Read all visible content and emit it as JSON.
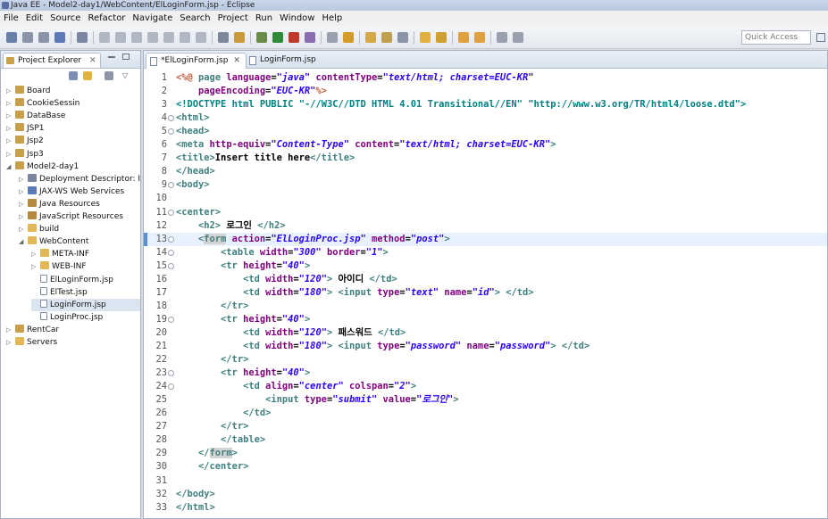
{
  "window": {
    "title": "Java EE - Model2-day1/WebContent/ElLoginForm.jsp - Eclipse"
  },
  "menu": [
    "File",
    "Edit",
    "Source",
    "Refactor",
    "Navigate",
    "Search",
    "Project",
    "Run",
    "Window",
    "Help"
  ],
  "quick_access": {
    "placeholder": "Quick Access"
  },
  "explorer": {
    "title": "Project Explorer",
    "items": [
      {
        "label": "Board",
        "depth": 0,
        "kind": "project",
        "open": false
      },
      {
        "label": "CookieSessin",
        "depth": 0,
        "kind": "project",
        "open": false
      },
      {
        "label": "DataBase",
        "depth": 0,
        "kind": "project",
        "open": false
      },
      {
        "label": "JSP1",
        "depth": 0,
        "kind": "project",
        "open": false
      },
      {
        "label": "Jsp2",
        "depth": 0,
        "kind": "project",
        "open": false
      },
      {
        "label": "Jsp3",
        "depth": 0,
        "kind": "project",
        "open": false
      },
      {
        "label": "Model2-day1",
        "depth": 0,
        "kind": "project",
        "open": true
      },
      {
        "label": "Deployment Descriptor: I",
        "depth": 1,
        "kind": "descriptor",
        "open": false
      },
      {
        "label": "JAX-WS Web Services",
        "depth": 1,
        "kind": "services",
        "open": false
      },
      {
        "label": "Java Resources",
        "depth": 1,
        "kind": "resources",
        "open": false
      },
      {
        "label": "JavaScript Resources",
        "depth": 1,
        "kind": "resources",
        "open": false
      },
      {
        "label": "build",
        "depth": 1,
        "kind": "folder",
        "open": false
      },
      {
        "label": "WebContent",
        "depth": 1,
        "kind": "folder",
        "open": true
      },
      {
        "label": "META-INF",
        "depth": 2,
        "kind": "folder",
        "open": false
      },
      {
        "label": "WEB-INF",
        "depth": 2,
        "kind": "folder",
        "open": false
      },
      {
        "label": "ElLoginForm.jsp",
        "depth": 2,
        "kind": "file",
        "open": null
      },
      {
        "label": "ElTest.jsp",
        "depth": 2,
        "kind": "file",
        "open": null
      },
      {
        "label": "LoginForm.jsp",
        "depth": 2,
        "kind": "file",
        "open": null,
        "selected": true
      },
      {
        "label": "LoginProc.jsp",
        "depth": 2,
        "kind": "file",
        "open": null
      },
      {
        "label": "RentCar",
        "depth": 0,
        "kind": "project",
        "open": false
      },
      {
        "label": "Servers",
        "depth": 0,
        "kind": "folder",
        "open": false
      }
    ]
  },
  "editor": {
    "tabs": [
      {
        "label": "*ElLoginForm.jsp",
        "active": true
      },
      {
        "label": "LoginForm.jsp",
        "active": false
      }
    ],
    "current_line": 13,
    "lines": [
      {
        "n": "1",
        "fold": false,
        "t": [
          [
            "j",
            "<%@"
          ],
          [
            "p",
            " "
          ],
          [
            "k",
            "page"
          ],
          [
            "p",
            " "
          ],
          [
            "a",
            "language"
          ],
          [
            "p",
            "="
          ],
          [
            "s",
            "\"java\""
          ],
          [
            "p",
            " "
          ],
          [
            "a",
            "contentType"
          ],
          [
            "p",
            "="
          ],
          [
            "s",
            "\"text/html; charset=EUC-KR\""
          ]
        ]
      },
      {
        "n": "2",
        "fold": false,
        "t": [
          [
            "p",
            "    "
          ],
          [
            "a",
            "pageEncoding"
          ],
          [
            "p",
            "="
          ],
          [
            "s",
            "\"EUC-KR\""
          ],
          [
            "j",
            "%>"
          ]
        ]
      },
      {
        "n": "3",
        "fold": false,
        "t": [
          [
            "d",
            "<!DOCTYPE"
          ],
          [
            "p",
            " "
          ],
          [
            "d",
            "html"
          ],
          [
            "p",
            " "
          ],
          [
            "d",
            "PUBLIC"
          ],
          [
            "p",
            " "
          ],
          [
            "d",
            "\"-//W3C//DTD HTML 4.01 Transitional//EN\""
          ],
          [
            "p",
            " "
          ],
          [
            "d",
            "\"http://www.w3.org/TR/html4/loose.dtd\""
          ],
          [
            "d",
            ">"
          ]
        ]
      },
      {
        "n": "4",
        "fold": true,
        "t": [
          [
            "k",
            "<html>"
          ]
        ]
      },
      {
        "n": "5",
        "fold": true,
        "t": [
          [
            "k",
            "<head>"
          ]
        ]
      },
      {
        "n": "6",
        "fold": false,
        "t": [
          [
            "k",
            "<meta"
          ],
          [
            "p",
            " "
          ],
          [
            "a",
            "http-equiv"
          ],
          [
            "p",
            "="
          ],
          [
            "s",
            "\"Content-Type\""
          ],
          [
            "p",
            " "
          ],
          [
            "a",
            "content"
          ],
          [
            "p",
            "="
          ],
          [
            "s",
            "\"text/html; charset=EUC-KR\""
          ],
          [
            "k",
            ">"
          ]
        ]
      },
      {
        "n": "7",
        "fold": false,
        "t": [
          [
            "k",
            "<title>"
          ],
          [
            "p",
            "Insert title here"
          ],
          [
            "k",
            "</title>"
          ]
        ]
      },
      {
        "n": "8",
        "fold": false,
        "t": [
          [
            "k",
            "</head>"
          ]
        ]
      },
      {
        "n": "9",
        "fold": true,
        "t": [
          [
            "k",
            "<body>"
          ]
        ]
      },
      {
        "n": "10",
        "fold": false,
        "t": []
      },
      {
        "n": "11",
        "fold": true,
        "t": [
          [
            "k",
            "<center>"
          ]
        ]
      },
      {
        "n": "12",
        "fold": false,
        "t": [
          [
            "p",
            "    "
          ],
          [
            "k",
            "<h2>"
          ],
          [
            "p",
            " 로그인 "
          ],
          [
            "k",
            "</h2>"
          ]
        ]
      },
      {
        "n": "13",
        "fold": true,
        "t": [
          [
            "p",
            "    "
          ],
          [
            "k",
            "<"
          ],
          [
            "k",
            "form",
            "hl"
          ],
          [
            "p",
            " "
          ],
          [
            "a",
            "action"
          ],
          [
            "p",
            "="
          ],
          [
            "s",
            "\"ElLoginProc.jsp\""
          ],
          [
            "p",
            " "
          ],
          [
            "a",
            "method"
          ],
          [
            "p",
            "="
          ],
          [
            "s",
            "\"post\""
          ],
          [
            "k",
            ">"
          ]
        ]
      },
      {
        "n": "14",
        "fold": true,
        "t": [
          [
            "p",
            "        "
          ],
          [
            "k",
            "<table"
          ],
          [
            "p",
            " "
          ],
          [
            "a",
            "width"
          ],
          [
            "p",
            "="
          ],
          [
            "s",
            "\"300\""
          ],
          [
            "p",
            " "
          ],
          [
            "a",
            "border"
          ],
          [
            "p",
            "="
          ],
          [
            "s",
            "\"1\""
          ],
          [
            "k",
            ">"
          ]
        ]
      },
      {
        "n": "15",
        "fold": true,
        "t": [
          [
            "p",
            "        "
          ],
          [
            "k",
            "<tr"
          ],
          [
            "p",
            " "
          ],
          [
            "a",
            "height"
          ],
          [
            "p",
            "="
          ],
          [
            "s",
            "\"40\""
          ],
          [
            "k",
            ">"
          ]
        ]
      },
      {
        "n": "16",
        "fold": false,
        "t": [
          [
            "p",
            "            "
          ],
          [
            "k",
            "<td"
          ],
          [
            "p",
            " "
          ],
          [
            "a",
            "width"
          ],
          [
            "p",
            "="
          ],
          [
            "s",
            "\"120\""
          ],
          [
            "k",
            ">"
          ],
          [
            "p",
            " 아이디 "
          ],
          [
            "k",
            "</td>"
          ]
        ]
      },
      {
        "n": "17",
        "fold": false,
        "t": [
          [
            "p",
            "            "
          ],
          [
            "k",
            "<td"
          ],
          [
            "p",
            " "
          ],
          [
            "a",
            "width"
          ],
          [
            "p",
            "="
          ],
          [
            "s",
            "\"180\""
          ],
          [
            "k",
            ">"
          ],
          [
            "p",
            " "
          ],
          [
            "k",
            "<input"
          ],
          [
            "p",
            " "
          ],
          [
            "a",
            "type"
          ],
          [
            "p",
            "="
          ],
          [
            "s",
            "\"text\""
          ],
          [
            "p",
            " "
          ],
          [
            "a",
            "name"
          ],
          [
            "p",
            "="
          ],
          [
            "s",
            "\"id\""
          ],
          [
            "k",
            ">"
          ],
          [
            "p",
            " "
          ],
          [
            "k",
            "</td>"
          ]
        ]
      },
      {
        "n": "18",
        "fold": false,
        "t": [
          [
            "p",
            "        "
          ],
          [
            "k",
            "</tr>"
          ]
        ]
      },
      {
        "n": "19",
        "fold": true,
        "t": [
          [
            "p",
            "        "
          ],
          [
            "k",
            "<tr"
          ],
          [
            "p",
            " "
          ],
          [
            "a",
            "height"
          ],
          [
            "p",
            "="
          ],
          [
            "s",
            "\"40\""
          ],
          [
            "k",
            ">"
          ]
        ]
      },
      {
        "n": "20",
        "fold": false,
        "t": [
          [
            "p",
            "            "
          ],
          [
            "k",
            "<td"
          ],
          [
            "p",
            " "
          ],
          [
            "a",
            "width"
          ],
          [
            "p",
            "="
          ],
          [
            "s",
            "\"120\""
          ],
          [
            "k",
            ">"
          ],
          [
            "p",
            " 패스워드 "
          ],
          [
            "k",
            "</td>"
          ]
        ]
      },
      {
        "n": "21",
        "fold": false,
        "t": [
          [
            "p",
            "            "
          ],
          [
            "k",
            "<td"
          ],
          [
            "p",
            " "
          ],
          [
            "a",
            "width"
          ],
          [
            "p",
            "="
          ],
          [
            "s",
            "\"180\""
          ],
          [
            "k",
            ">"
          ],
          [
            "p",
            " "
          ],
          [
            "k",
            "<input"
          ],
          [
            "p",
            " "
          ],
          [
            "a",
            "type"
          ],
          [
            "p",
            "="
          ],
          [
            "s",
            "\"password\""
          ],
          [
            "p",
            " "
          ],
          [
            "a",
            "name"
          ],
          [
            "p",
            "="
          ],
          [
            "s",
            "\"password\""
          ],
          [
            "k",
            ">"
          ],
          [
            "p",
            " "
          ],
          [
            "k",
            "</td>"
          ]
        ]
      },
      {
        "n": "22",
        "fold": false,
        "t": [
          [
            "p",
            "        "
          ],
          [
            "k",
            "</tr>"
          ]
        ]
      },
      {
        "n": "23",
        "fold": true,
        "t": [
          [
            "p",
            "        "
          ],
          [
            "k",
            "<tr"
          ],
          [
            "p",
            " "
          ],
          [
            "a",
            "height"
          ],
          [
            "p",
            "="
          ],
          [
            "s",
            "\"40\""
          ],
          [
            "k",
            ">"
          ]
        ]
      },
      {
        "n": "24",
        "fold": true,
        "t": [
          [
            "p",
            "            "
          ],
          [
            "k",
            "<td"
          ],
          [
            "p",
            " "
          ],
          [
            "a",
            "align"
          ],
          [
            "p",
            "="
          ],
          [
            "s",
            "\"center\""
          ],
          [
            "p",
            " "
          ],
          [
            "a",
            "colspan"
          ],
          [
            "p",
            "="
          ],
          [
            "s",
            "\"2\""
          ],
          [
            "k",
            ">"
          ]
        ]
      },
      {
        "n": "25",
        "fold": false,
        "t": [
          [
            "p",
            "                "
          ],
          [
            "k",
            "<input"
          ],
          [
            "p",
            " "
          ],
          [
            "a",
            "type"
          ],
          [
            "p",
            "="
          ],
          [
            "s",
            "\"submit\""
          ],
          [
            "p",
            " "
          ],
          [
            "a",
            "value"
          ],
          [
            "p",
            "="
          ],
          [
            "s",
            "\"로그인\""
          ],
          [
            "k",
            ">"
          ]
        ]
      },
      {
        "n": "26",
        "fold": false,
        "t": [
          [
            "p",
            "            "
          ],
          [
            "k",
            "</td>"
          ]
        ]
      },
      {
        "n": "27",
        "fold": false,
        "t": [
          [
            "p",
            "        "
          ],
          [
            "k",
            "</tr>"
          ]
        ]
      },
      {
        "n": "28",
        "fold": false,
        "t": [
          [
            "p",
            "        "
          ],
          [
            "k",
            "</table>"
          ]
        ]
      },
      {
        "n": "29",
        "fold": false,
        "t": [
          [
            "p",
            "    "
          ],
          [
            "k",
            "</"
          ],
          [
            "k",
            "form",
            "hl"
          ],
          [
            "k",
            ">"
          ]
        ]
      },
      {
        "n": "30",
        "fold": false,
        "t": [
          [
            "p",
            "    "
          ],
          [
            "k",
            "</center>"
          ]
        ]
      },
      {
        "n": "31",
        "fold": false,
        "t": []
      },
      {
        "n": "32",
        "fold": false,
        "t": [
          [
            "k",
            "</body>"
          ]
        ]
      },
      {
        "n": "33",
        "fold": false,
        "t": [
          [
            "k",
            "</html>"
          ]
        ]
      }
    ]
  }
}
